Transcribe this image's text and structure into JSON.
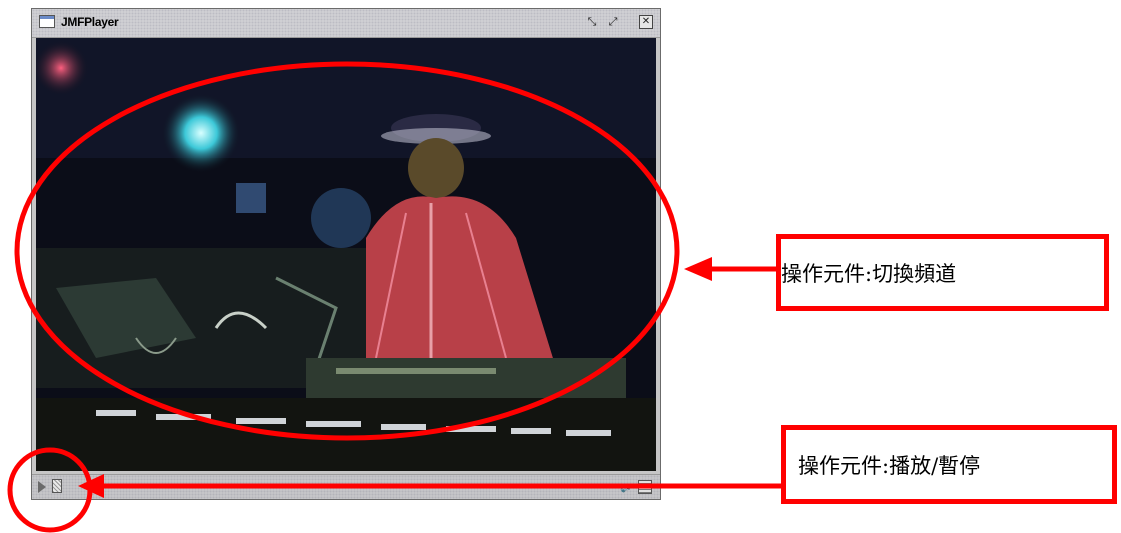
{
  "window": {
    "title": "JMFPlayer",
    "buttons": {
      "minimize": "▫↙",
      "maximize": "↗",
      "close": "✕"
    }
  },
  "controls": {
    "play_icon": "play-icon",
    "seek_icon": "seek-slider",
    "volume_icon": "volume-icon",
    "info_icon": "media-info-icon"
  },
  "annotations": {
    "channel": "操作元件:切換頻道",
    "play_pause": "操作元件:播放/暫停"
  },
  "colors": {
    "annotation": "#ff0000",
    "titlebar": "#d3d3d6",
    "video_bg": "#0b0d18"
  }
}
